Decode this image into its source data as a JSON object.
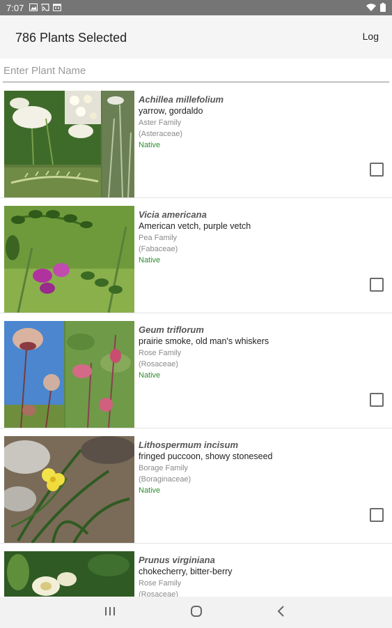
{
  "status_bar": {
    "time": "7:07"
  },
  "header": {
    "title": "786 Plants Selected",
    "log_label": "Log"
  },
  "search": {
    "placeholder": "Enter Plant Name",
    "value": ""
  },
  "plants": [
    {
      "scientific": "Achillea millefolium",
      "common": "yarrow, gordaldo",
      "family": "Aster Family",
      "family_latin": "(Asteraceae)",
      "status": "Native",
      "checked": false
    },
    {
      "scientific": "Vicia americana",
      "common": "American vetch, purple vetch",
      "family": "Pea Family",
      "family_latin": "(Fabaceae)",
      "status": "Native",
      "checked": false
    },
    {
      "scientific": "Geum triflorum",
      "common": "prairie smoke, old man's whiskers",
      "family": "Rose Family",
      "family_latin": "(Rosaceae)",
      "status": "Native",
      "checked": false
    },
    {
      "scientific": "Lithospermum incisum",
      "common": "fringed puccoon, showy stoneseed",
      "family": "Borage Family",
      "family_latin": "(Boraginaceae)",
      "status": "Native",
      "checked": false
    },
    {
      "scientific": "Prunus virginiana",
      "common": "chokecherry, bitter-berry",
      "family": "Rose Family",
      "family_latin": "(Rosaceae)",
      "status": "",
      "checked": false
    }
  ],
  "colors": {
    "native": "#2e8b2e",
    "status_bar": "#757575",
    "header_bg": "#f5f5f5"
  },
  "icons": {
    "status_left": [
      "image-icon",
      "cast-icon",
      "calendar-icon"
    ],
    "status_right": [
      "wifi-icon",
      "battery-icon"
    ],
    "nav": [
      "recents-icon",
      "home-icon",
      "back-icon"
    ]
  }
}
